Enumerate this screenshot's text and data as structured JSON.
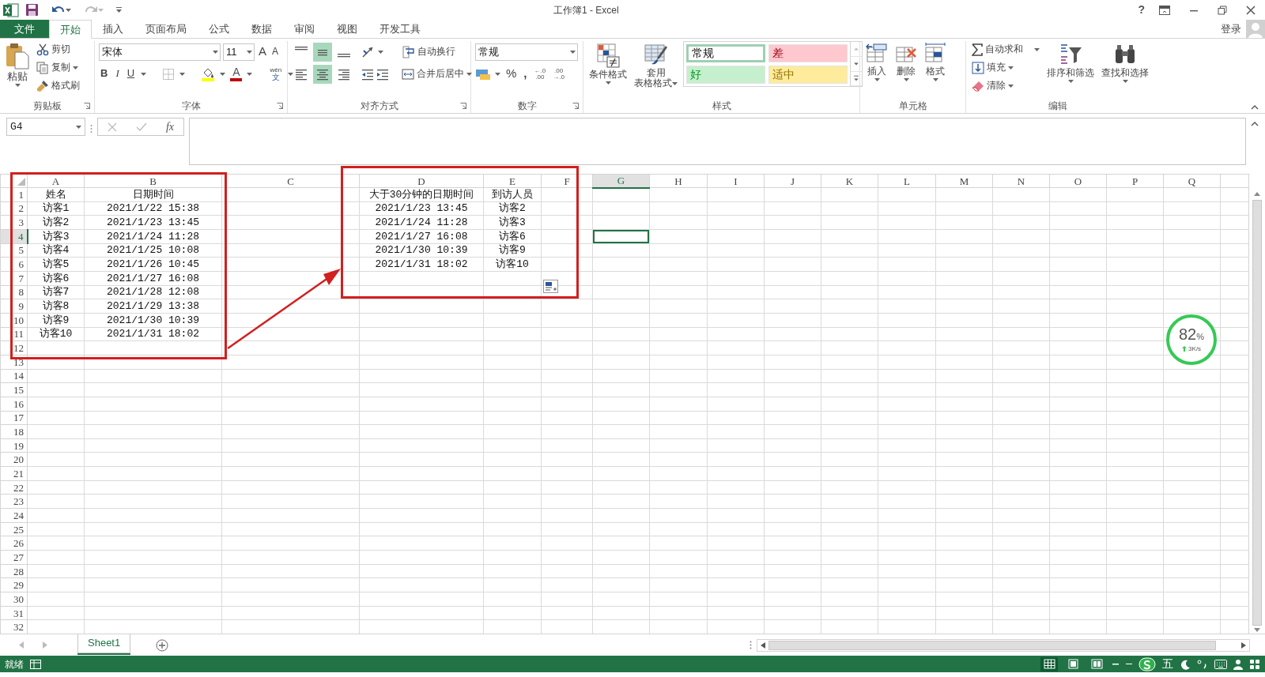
{
  "title_bar": {
    "title": "工作簿1 - Excel",
    "help": "?"
  },
  "ribbon_tabs": [
    {
      "label": "文件",
      "kind": "file",
      "selected": false
    },
    {
      "label": "开始",
      "kind": "tab",
      "selected": true
    },
    {
      "label": "插入",
      "kind": "tab",
      "selected": false
    },
    {
      "label": "页面布局",
      "kind": "tab",
      "selected": false
    },
    {
      "label": "公式",
      "kind": "tab",
      "selected": false
    },
    {
      "label": "数据",
      "kind": "tab",
      "selected": false
    },
    {
      "label": "审阅",
      "kind": "tab",
      "selected": false
    },
    {
      "label": "视图",
      "kind": "tab",
      "selected": false
    },
    {
      "label": "开发工具",
      "kind": "tab",
      "selected": false
    }
  ],
  "account": {
    "sign_in": "登录"
  },
  "ribbon": {
    "clipboard": {
      "title": "剪贴板",
      "paste": "粘贴",
      "cut": "剪切",
      "copy": "复制",
      "format_painter": "格式刷"
    },
    "font": {
      "title": "字体",
      "font_name": "宋体",
      "font_size": "11",
      "grow": "A",
      "shrink": "A",
      "bold": "B",
      "italic": "I",
      "underline": "U",
      "font_color": "A",
      "phonetic_top": "wén",
      "phonetic_bottom": "文"
    },
    "alignment": {
      "title": "对齐方式",
      "vertical": [
        {
          "selected": false
        },
        {
          "selected": true
        },
        {
          "selected": false
        }
      ],
      "horizontal": [
        {
          "selected": false
        },
        {
          "selected": true
        },
        {
          "selected": false
        }
      ],
      "wrap": "自动换行",
      "merge": "合并后居中"
    },
    "number": {
      "title": "数字",
      "format": "常规",
      "percent": "%",
      "comma": ",",
      "increase_decimal": [
        "←.0",
        ".00"
      ],
      "decrease_decimal": [
        ".00",
        "→.0"
      ]
    },
    "styles": {
      "title": "样式",
      "conditional": "条件格式",
      "table_top": "套用",
      "table_bottom": "表格格式",
      "gallery": [
        {
          "label": "常规",
          "color": "#ffffff",
          "selected": true
        },
        {
          "label": "差",
          "color": "#ffc7ce",
          "selected": false
        },
        {
          "label": "好",
          "color": "#c6efce",
          "selected": false
        },
        {
          "label": "适中",
          "color": "#ffeb9c",
          "selected": false
        }
      ]
    },
    "cells": {
      "title": "单元格",
      "insert": "插入",
      "delete": "删除",
      "format": "格式"
    },
    "editing": {
      "title": "编辑",
      "autosum": "自动求和",
      "fill": "填充",
      "clear": "清除",
      "sort": "排序和筛选",
      "find": "查找和选择"
    }
  },
  "formula_bar": {
    "name_box": "G4",
    "fx": "fx"
  },
  "sheet": {
    "columns": [
      {
        "label": "A",
        "selected": false
      },
      {
        "label": "B",
        "selected": false
      },
      {
        "label": "C",
        "selected": false
      },
      {
        "label": "D",
        "selected": false
      },
      {
        "label": "E",
        "selected": false
      },
      {
        "label": "F",
        "selected": false
      },
      {
        "label": "G",
        "selected": true
      },
      {
        "label": "H",
        "selected": false
      },
      {
        "label": "I",
        "selected": false
      },
      {
        "label": "J",
        "selected": false
      },
      {
        "label": "K",
        "selected": false
      },
      {
        "label": "L",
        "selected": false
      },
      {
        "label": "M",
        "selected": false
      },
      {
        "label": "N",
        "selected": false
      },
      {
        "label": "O",
        "selected": false
      },
      {
        "label": "P",
        "selected": false
      },
      {
        "label": "Q",
        "selected": false
      },
      {
        "selected": false
      }
    ],
    "rows": [
      {
        "header": "1",
        "selected": false,
        "cells": [
          "姓名",
          "日期时间",
          null,
          "大于30分钟的日期时间",
          "到访人员"
        ]
      },
      {
        "header": "2",
        "selected": false,
        "cells": [
          "访客1",
          "2021/1/22 15:38",
          null,
          "2021/1/23 13:45",
          "访客2"
        ]
      },
      {
        "header": "3",
        "selected": false,
        "cells": [
          "访客2",
          "2021/1/23 13:45",
          null,
          "2021/1/24 11:28",
          "访客3"
        ]
      },
      {
        "header": "4",
        "selected": true,
        "cells": [
          "访客3",
          "2021/1/24 11:28",
          null,
          "2021/1/27 16:08",
          "访客6"
        ]
      },
      {
        "header": "5",
        "selected": false,
        "cells": [
          "访客4",
          "2021/1/25 10:08",
          null,
          "2021/1/30 10:39",
          "访客9"
        ]
      },
      {
        "header": "6",
        "selected": false,
        "cells": [
          "访客5",
          "2021/1/26 10:45",
          null,
          "2021/1/31 18:02",
          "访客10"
        ]
      },
      {
        "header": "7",
        "selected": false,
        "cells": [
          "访客6",
          "2021/1/27 16:08"
        ]
      },
      {
        "header": "8",
        "selected": false,
        "cells": [
          "访客7",
          "2021/1/28 12:08"
        ]
      },
      {
        "header": "9",
        "selected": false,
        "cells": [
          "访客8",
          "2021/1/29 13:38"
        ]
      },
      {
        "header": "10",
        "selected": false,
        "cells": [
          "访客9",
          "2021/1/30 10:39"
        ]
      },
      {
        "header": "11",
        "selected": false,
        "cells": [
          "访客10",
          "2021/1/31 18:02"
        ]
      },
      {
        "header": "12",
        "selected": false
      },
      {
        "header": "13",
        "selected": false
      },
      {
        "header": "14",
        "selected": false
      },
      {
        "header": "15",
        "selected": false
      },
      {
        "header": "16",
        "selected": false
      },
      {
        "header": "17",
        "selected": false
      },
      {
        "header": "18",
        "selected": false
      },
      {
        "header": "19",
        "selected": false
      },
      {
        "header": "20",
        "selected": false
      },
      {
        "header": "21",
        "selected": false
      },
      {
        "header": "22",
        "selected": false
      },
      {
        "header": "23",
        "selected": false
      },
      {
        "header": "24",
        "selected": false
      },
      {
        "header": "25",
        "selected": false
      },
      {
        "header": "26",
        "selected": false
      },
      {
        "header": "27",
        "selected": false
      },
      {
        "header": "28",
        "selected": false
      },
      {
        "header": "29",
        "selected": false
      },
      {
        "header": "30",
        "selected": false
      },
      {
        "header": "31",
        "selected": false
      },
      {
        "header": "32",
        "selected": false
      }
    ]
  },
  "sheet_tabs": [
    {
      "label": "Sheet1",
      "selected": true
    }
  ],
  "status_bar": {
    "ready": "就绪",
    "views": [
      {
        "selected": true
      },
      {
        "selected": false
      },
      {
        "selected": false
      }
    ],
    "ime": "五"
  },
  "speed_widget": {
    "percent": "82",
    "percent_sign": "%",
    "speed": "3K/s"
  }
}
